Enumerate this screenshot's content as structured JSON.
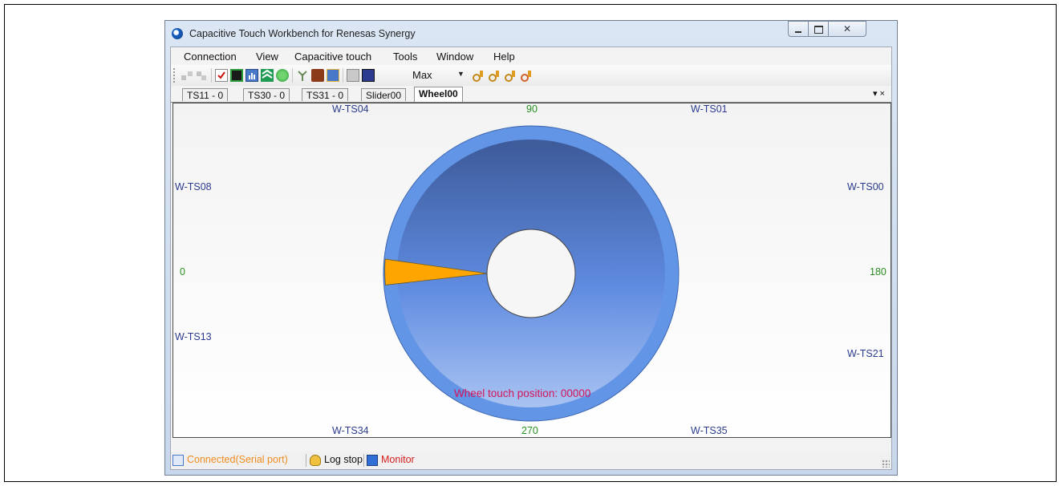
{
  "window": {
    "title": "Capacitive Touch Workbench for Renesas Synergy"
  },
  "menu": [
    "Connection",
    "View",
    "Capacitive touch",
    "Tools",
    "Window",
    "Help"
  ],
  "toolbar": {
    "zoom_value": "Max"
  },
  "tabs": [
    "TS11 - 0",
    "TS30 - 0",
    "TS31 - 0",
    "Slider00",
    "Wheel00"
  ],
  "tab_controls": "▾ ×",
  "wheel": {
    "sensor_labels": {
      "top_left": "W-TS04",
      "top_right": "W-TS01",
      "left_upper": "W-TS08",
      "right_upper": "W-TS00",
      "left_lower": "W-TS13",
      "right_lower": "W-TS21",
      "bottom_left": "W-TS34",
      "bottom_right": "W-TS35"
    },
    "degree_labels": {
      "top": "90",
      "left": "0",
      "right": "180",
      "bottom": "270"
    },
    "touch_position_text": "Wheel touch position: 00000",
    "colors": {
      "ring": "#5b8fdc",
      "highlight": "#ffa500"
    }
  },
  "status": {
    "connection": "Connected(Serial port)",
    "log": "Log stop",
    "monitor": "Monitor",
    "colors": {
      "connection": "#f08c1e",
      "monitor": "#d42020"
    }
  }
}
